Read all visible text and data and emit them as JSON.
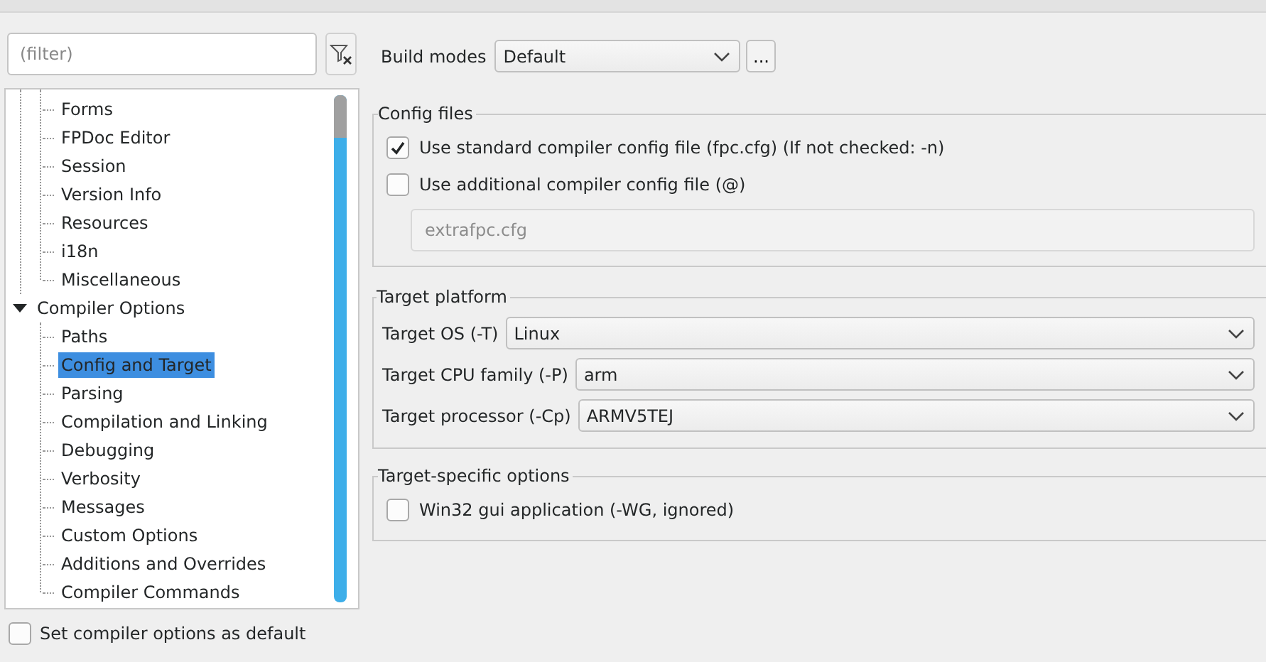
{
  "filter": {
    "placeholder": "(filter)"
  },
  "tree": {
    "upper_items": [
      {
        "label": "Forms",
        "selected": false
      },
      {
        "label": "FPDoc Editor",
        "selected": false
      },
      {
        "label": "Session",
        "selected": false
      },
      {
        "label": "Version Info",
        "selected": false
      },
      {
        "label": "Resources",
        "selected": false
      },
      {
        "label": "i18n",
        "selected": false
      },
      {
        "label": "Miscellaneous",
        "selected": false
      }
    ],
    "groups": [
      {
        "label": "Compiler Options",
        "expanded": true,
        "selected": false,
        "children": [
          {
            "label": "Paths",
            "selected": false
          },
          {
            "label": "Config and Target",
            "selected": true
          },
          {
            "label": "Parsing",
            "selected": false
          },
          {
            "label": "Compilation and Linking",
            "selected": false
          },
          {
            "label": "Debugging",
            "selected": false
          },
          {
            "label": "Verbosity",
            "selected": false
          },
          {
            "label": "Messages",
            "selected": false
          },
          {
            "label": "Custom Options",
            "selected": false
          },
          {
            "label": "Additions and Overrides",
            "selected": false
          },
          {
            "label": "Compiler Commands",
            "selected": false
          }
        ]
      }
    ]
  },
  "default_option": {
    "label": "Set compiler options as default",
    "checked": false
  },
  "build_modes": {
    "label": "Build modes",
    "value": "Default",
    "button": "..."
  },
  "config_files": {
    "title": "Config files",
    "options": [
      {
        "label": "Use standard compiler config file (fpc.cfg) (If not checked: -n)",
        "checked": true
      },
      {
        "label": "Use additional compiler config file (@)",
        "checked": false
      }
    ],
    "file_field": {
      "value": "extrafpc.cfg",
      "disabled": true
    }
  },
  "target_platform": {
    "title": "Target platform",
    "rows": [
      {
        "label": "Target OS (-T)",
        "value": "Linux"
      },
      {
        "label": "Target CPU family (-P)",
        "value": "arm"
      },
      {
        "label": "Target processor (-Cp)",
        "value": "ARMV5TEJ"
      }
    ]
  },
  "target_specific": {
    "title": "Target-specific options",
    "options": [
      {
        "label": "Win32 gui application (-WG, ignored)",
        "checked": false
      }
    ]
  }
}
